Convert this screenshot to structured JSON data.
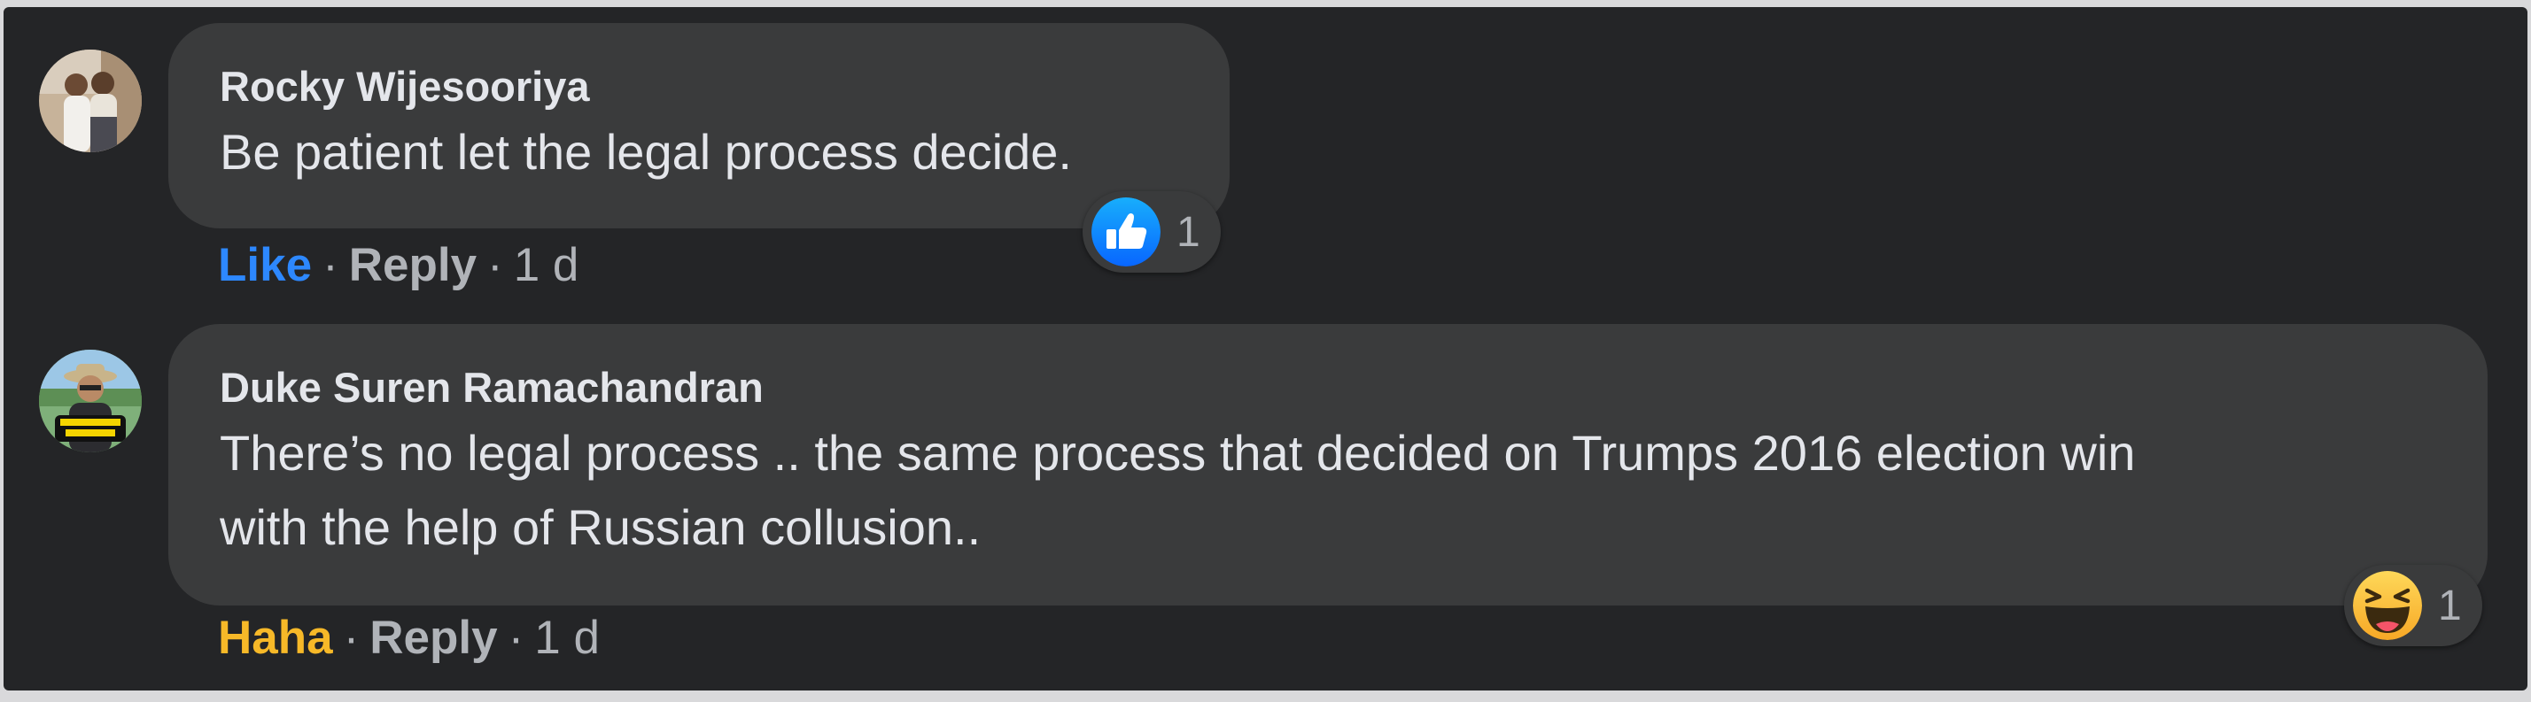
{
  "comments": [
    {
      "author": "Rocky Wijesooriya",
      "text": "Be patient let the legal process decide.",
      "reaction_label": "Like",
      "reaction_color": "#2d88ff",
      "reply_label": "Reply",
      "separator": "·",
      "time": "1 d",
      "reaction_icon": "thumbs-up-icon",
      "reaction_count": "1"
    },
    {
      "author": "Duke Suren Ramachandran",
      "text_line1": "There’s no legal process .. the same process that decided on Trumps 2016 election win",
      "text_line2": "with the help of Russian collusion..",
      "reaction_label": "Haha",
      "reaction_color": "#f7b928",
      "reply_label": "Reply",
      "separator": "·",
      "time": "1 d",
      "reaction_icon": "haha-emoji-icon",
      "reaction_count": "1"
    }
  ],
  "colors": {
    "background": "#242527",
    "bubble": "#3a3b3c",
    "text": "#e4e6eb",
    "secondary": "#b0b3b8"
  }
}
